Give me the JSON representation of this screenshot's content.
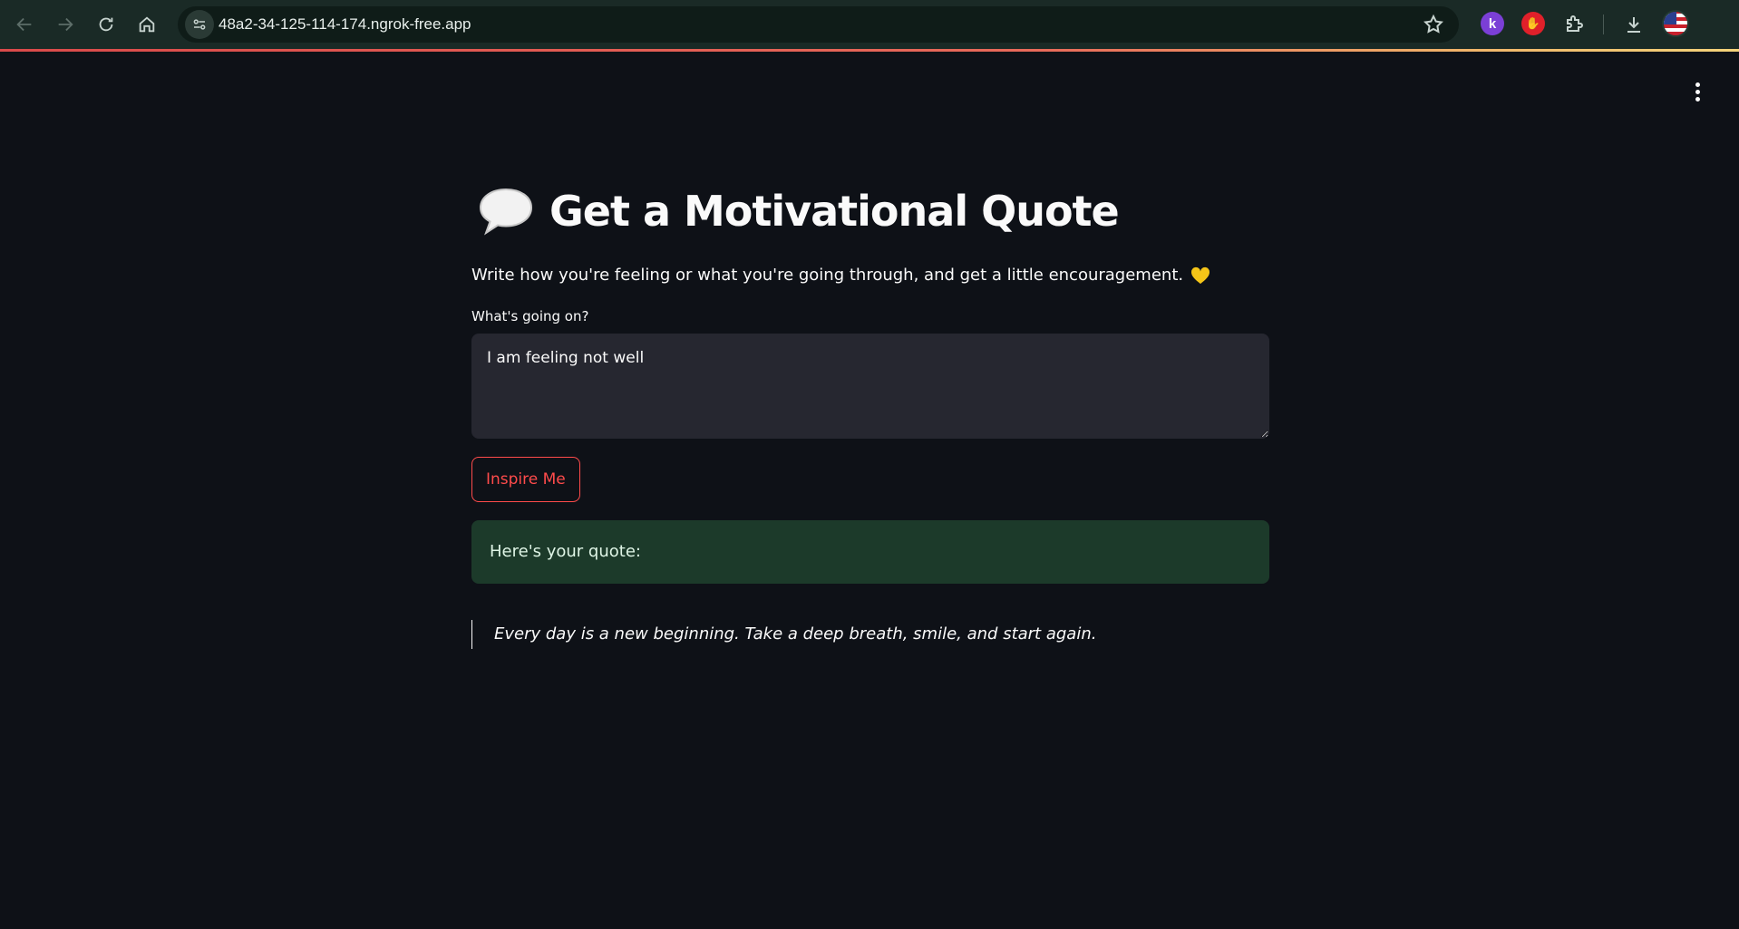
{
  "browser": {
    "url": "48a2-34-125-114-174.ngrok-free.app",
    "extensions": {
      "k_label": "k",
      "stop_label": "✋"
    },
    "icons": [
      "back-icon",
      "forward-icon",
      "reload-icon",
      "home-icon",
      "site-info-icon",
      "bookmark-star-icon",
      "puzzle-icon",
      "download-icon"
    ]
  },
  "app": {
    "title": "Get a Motivational Quote",
    "subtitle": "Write how you're feeling or what you're going through, and get a little encouragement.",
    "input": {
      "label": "What's going on?",
      "value": "I am feeling not well"
    },
    "button_label": "Inspire Me",
    "success_text": "Here's your quote:",
    "quote": "Every day is a new beginning. Take a deep breath, smile, and start again."
  },
  "colors": {
    "background": "#0e1117",
    "accent": "#ff4b4b",
    "success_bg": "#1c3a2a",
    "input_bg": "#262730"
  }
}
